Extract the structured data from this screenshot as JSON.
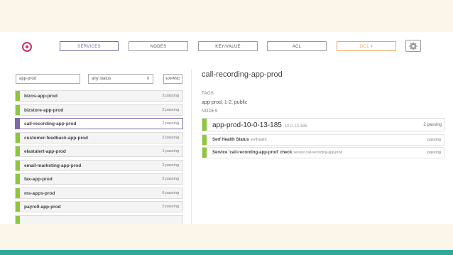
{
  "nav": {
    "services": "SERVICES",
    "nodes": "NODES",
    "key_value": "KEY/VALUE",
    "acl": "ACL",
    "datacenter": "DC1 ▾"
  },
  "filters": {
    "search_value": "app-prod",
    "status_value": "any status",
    "expand_label": "EXPAND"
  },
  "services": [
    {
      "name": "bizos-app-prod",
      "status": "2 passing"
    },
    {
      "name": "bizstore-app-prod",
      "status": "2 passing"
    },
    {
      "name": "call-recording-app-prod",
      "status": "2 passing"
    },
    {
      "name": "customer-feedback-app-prod",
      "status": "2 passing"
    },
    {
      "name": "elastalert-app-prod",
      "status": "1 passing"
    },
    {
      "name": "email-marketing-app-prod",
      "status": "2 passing"
    },
    {
      "name": "fax-app-prod",
      "status": "2 passing"
    },
    {
      "name": "ms-apps-prod",
      "status": "6 passing"
    },
    {
      "name": "payroll-app-prod",
      "status": "2 passing"
    }
  ],
  "detail": {
    "title": "call-recording-app-prod",
    "tags_label": "TAGS",
    "tags_value": "app-prod, 1-2, public",
    "nodes_label": "NODES",
    "node": {
      "name": "app-prod-10-0-13-185",
      "ip": "10.0.13.185",
      "status": "2 passing"
    },
    "checks": [
      {
        "name": "Serf Health Status",
        "id": "serfHealth",
        "status": "passing"
      },
      {
        "name": "Service 'call-recording-app-prod' check",
        "id": "service:call-recording-app-prod",
        "status": "passing"
      }
    ]
  },
  "colors": {
    "accent": "#7b68a6",
    "passing": "#8dc63f",
    "logo": "#c8336b",
    "datacenter": "#f2a65a",
    "footer": "#2fa89c"
  }
}
